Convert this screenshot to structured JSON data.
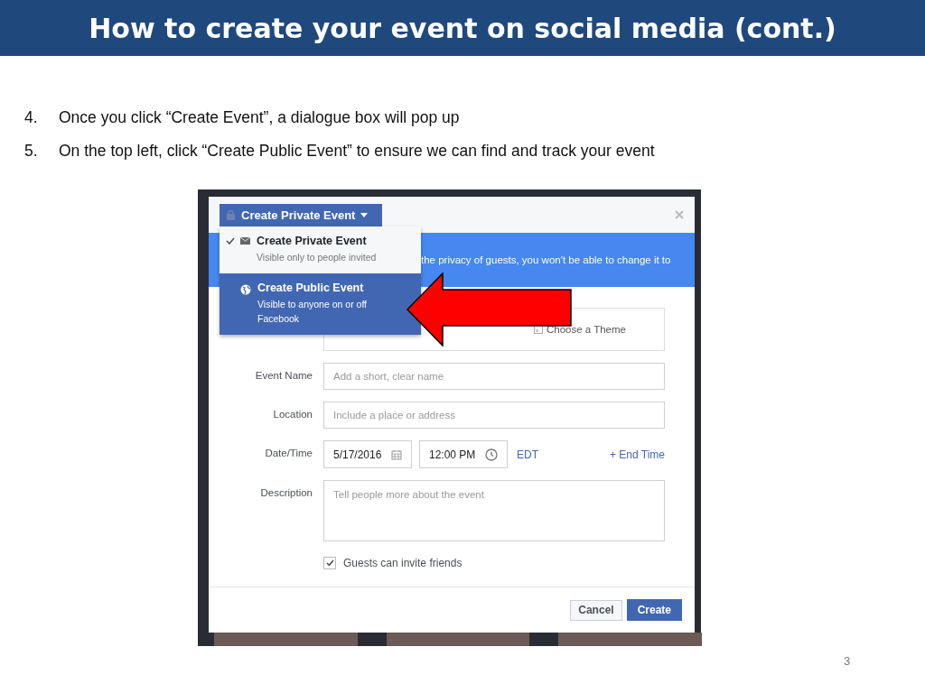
{
  "slide": {
    "title": "How to create your event on social media (cont.)",
    "bullets": [
      {
        "number": "4.",
        "text": "Once you click “Create Event”, a dialogue box will pop up"
      },
      {
        "number": "5.",
        "text": "On the top left, click “Create Public Event” to ensure we can find and track your event"
      }
    ],
    "page_number": "3"
  },
  "dialog": {
    "privacy_button": "Create Private Event",
    "privacy_menu": [
      {
        "title": "Create Private Event",
        "subtitle": "Visible only to people invited",
        "checked": true,
        "selected": false,
        "kind": "envelope"
      },
      {
        "title": "Create Public Event",
        "subtitle": "Visible to anyone on or off Facebook",
        "checked": false,
        "selected": true,
        "kind": "globe"
      }
    ],
    "notice": "the privacy of guests, you won't be able to change it to",
    "theme_option": "Choose a Theme",
    "fields": [
      {
        "label": "Event Name",
        "placeholder": "Add a short, clear name"
      },
      {
        "label": "Location",
        "placeholder": "Include a place or address"
      }
    ],
    "date_time": {
      "label": "Date/Time",
      "date": "5/17/2016",
      "time": "12:00 PM",
      "timezone": "EDT",
      "end_time_link": "+ End Time"
    },
    "description": {
      "label": "Description",
      "placeholder": "Tell people more about the event"
    },
    "guests_can_invite": {
      "label": "Guests can invite friends",
      "checked": true
    },
    "buttons": {
      "cancel": "Cancel",
      "create": "Create"
    }
  }
}
